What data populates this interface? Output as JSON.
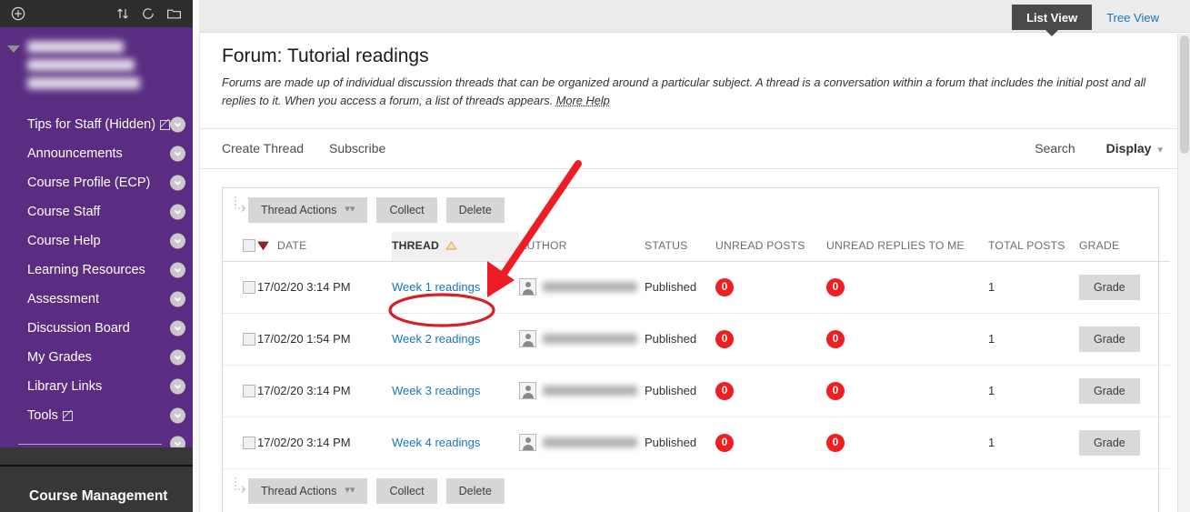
{
  "sidebar": {
    "toolbar_icons": [
      "add-circle-icon",
      "reorder-icon",
      "refresh-icon",
      "folder-icon"
    ],
    "course_title_blurred": true,
    "items": [
      {
        "label": "Tips for Staff (Hidden)",
        "external": true
      },
      {
        "label": "Announcements",
        "external": false
      },
      {
        "label": "Course Profile (ECP)",
        "external": false
      },
      {
        "label": "Course Staff",
        "external": false
      },
      {
        "label": "Course Help",
        "external": false
      },
      {
        "label": "Learning Resources",
        "external": false
      },
      {
        "label": "Assessment",
        "external": false
      },
      {
        "label": "Discussion Board",
        "external": false
      },
      {
        "label": "My Grades",
        "external": false
      },
      {
        "label": "Library Links",
        "external": false
      },
      {
        "label": "Tools",
        "external": true
      }
    ],
    "course_management_label": "Course Management"
  },
  "viewbar": {
    "tabs": [
      {
        "label": "List View",
        "active": true
      },
      {
        "label": "Tree View",
        "active": false
      }
    ]
  },
  "page": {
    "title": "Forum: Tutorial readings",
    "description": "Forums are made up of individual discussion threads that can be organized around a particular subject. A thread is a conversation within a forum that includes the initial post and all replies to it. When you access a forum, a list of threads appears.",
    "more_help_label": "More Help"
  },
  "actionbar": {
    "create_thread_label": "Create Thread",
    "subscribe_label": "Subscribe",
    "search_label": "Search",
    "display_label": "Display",
    "display_caret": "⌄"
  },
  "toolbar": {
    "thread_actions_label": "Thread Actions",
    "collect_label": "Collect",
    "delete_label": "Delete",
    "dropdown_caret": "»"
  },
  "table": {
    "columns": [
      {
        "key": "checkbox",
        "label": ""
      },
      {
        "key": "date",
        "label": "DATE",
        "sort": "desc"
      },
      {
        "key": "thread",
        "label": "THREAD",
        "sort": "asc",
        "active": true
      },
      {
        "key": "author",
        "label": "AUTHOR"
      },
      {
        "key": "status",
        "label": "STATUS"
      },
      {
        "key": "unread_posts",
        "label": "UNREAD POSTS"
      },
      {
        "key": "unread_replies",
        "label": "UNREAD REPLIES TO ME"
      },
      {
        "key": "total_posts",
        "label": "TOTAL POSTS"
      },
      {
        "key": "grade",
        "label": "GRADE"
      }
    ],
    "rows": [
      {
        "date": "17/02/20 3:14 PM",
        "thread": "Week 1 readings",
        "author_blurred": true,
        "status": "Published",
        "unread_posts": "0",
        "unread_replies": "0",
        "total_posts": "1",
        "grade_label": "Grade",
        "highlighted": true
      },
      {
        "date": "17/02/20 1:54 PM",
        "thread": "Week 2 readings",
        "author_blurred": true,
        "status": "Published",
        "unread_posts": "0",
        "unread_replies": "0",
        "total_posts": "1",
        "grade_label": "Grade",
        "highlighted": false
      },
      {
        "date": "17/02/20 3:14 PM",
        "thread": "Week 3 readings",
        "author_blurred": true,
        "status": "Published",
        "unread_posts": "0",
        "unread_replies": "0",
        "total_posts": "1",
        "grade_label": "Grade",
        "highlighted": false
      },
      {
        "date": "17/02/20 3:14 PM",
        "thread": "Week 4 readings",
        "author_blurred": true,
        "status": "Published",
        "unread_posts": "0",
        "unread_replies": "0",
        "total_posts": "1",
        "grade_label": "Grade",
        "highlighted": false
      }
    ]
  },
  "annotations": {
    "arrow_color": "#ee1c25",
    "ellipse_color": "#d81f26",
    "target": "Week 1 readings"
  },
  "colors": {
    "sidebar_purple": "#5a2d82",
    "toolbar_dark": "#2e2e2e",
    "link_blue": "#1b75bb",
    "badge_red": "#f01e20",
    "active_tab": "#4a4a4a"
  }
}
